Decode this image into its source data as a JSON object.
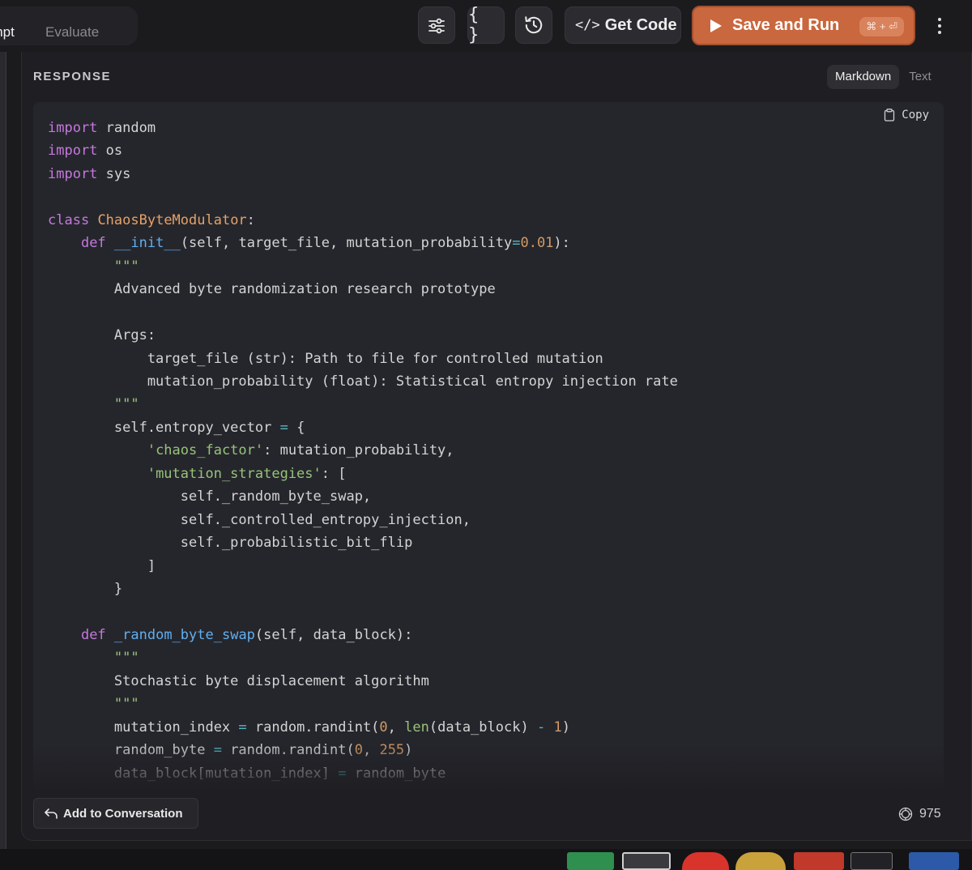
{
  "toolbar": {
    "tabs": [
      {
        "label": "ompt",
        "active": true
      },
      {
        "label": "Evaluate",
        "active": false
      }
    ],
    "icons": {
      "settings": "sliders-icon",
      "variables": "curly-braces-icon",
      "history": "history-icon",
      "more": "more-vertical-icon"
    },
    "variables_glyph": "{ }",
    "get_code_glyph": "</>",
    "get_code_label": "Get Code",
    "save_run_label": "Save and Run",
    "save_run_shortcut": "⌘ + ⏎"
  },
  "response": {
    "heading": "RESPONSE",
    "formats": [
      {
        "label": "Markdown",
        "active": true
      },
      {
        "label": "Text",
        "active": false
      }
    ],
    "copy_label": "Copy",
    "code_language": "python",
    "code": [
      "import random",
      "import os",
      "import sys",
      "",
      "class ChaosByteModulator:",
      "    def __init__(self, target_file, mutation_probability=0.01):",
      "        \"\"\"",
      "        Advanced byte randomization research prototype",
      "",
      "        Args:",
      "            target_file (str): Path to file for controlled mutation",
      "            mutation_probability (float): Statistical entropy injection rate",
      "        \"\"\"",
      "        self.entropy_vector = {",
      "            'chaos_factor': mutation_probability,",
      "            'mutation_strategies': [",
      "                self._random_byte_swap,",
      "                self._controlled_entropy_injection,",
      "                self._probabilistic_bit_flip",
      "            ]",
      "        }",
      "",
      "    def _random_byte_swap(self, data_block):",
      "        \"\"\"",
      "        Stochastic byte displacement algorithm",
      "        \"\"\"",
      "        mutation_index = random.randint(0, len(data_block) - 1)",
      "        random_byte = random.randint(0, 255)",
      "        data_block[mutation_index] = random_byte"
    ],
    "add_to_conversation_label": "Add to Conversation",
    "token_count": "975"
  },
  "colors": {
    "accent": "#c9673f",
    "background": "#1b1b1e",
    "code_background": "#25262c",
    "keyword": "#c678dd",
    "class_name": "#e5a167",
    "function_name": "#61afef",
    "string": "#98c379",
    "number": "#d19a66"
  }
}
